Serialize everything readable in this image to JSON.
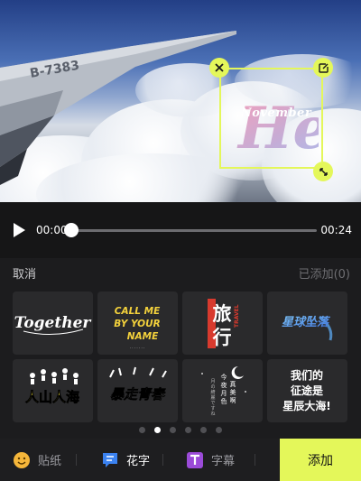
{
  "player": {
    "current_time": "00:00",
    "total_time": "00:24",
    "progress": 0.0
  },
  "sticker_overlay": {
    "text_hey": "Hey",
    "text_month": "November",
    "close_icon": "close-icon",
    "edit_icon": "edit-icon",
    "resize_icon": "resize-icon"
  },
  "panel": {
    "cancel_label": "取消",
    "added_label": "已添加(0)",
    "page_count": 6,
    "active_page": 1,
    "tiles": [
      {
        "text": "Together",
        "sub": ""
      },
      {
        "text": "CALL ME BY YOUR NAME",
        "sub": ""
      },
      {
        "text": "旅行",
        "sub": "TRAVEL"
      },
      {
        "text": "星球坠落",
        "sub": ""
      },
      {
        "text": "人山人海",
        "sub": ""
      },
      {
        "text": "暴走青春",
        "sub": ""
      },
      {
        "text": "今夜月色真美啊",
        "sub": "月の綺麗ですね"
      },
      {
        "text": "我们的征途是星辰大海!",
        "sub": ""
      }
    ]
  },
  "tabs": [
    {
      "label": "贴纸",
      "icon": "smiley-icon"
    },
    {
      "label": "花字",
      "icon": "text-bubble-icon"
    },
    {
      "label": "字幕",
      "icon": "subtitle-t-icon"
    }
  ],
  "add_button_label": "添加",
  "colors": {
    "accent": "#e4f75a",
    "background": "#1c1c1e",
    "tile": "#2a2a2c"
  }
}
